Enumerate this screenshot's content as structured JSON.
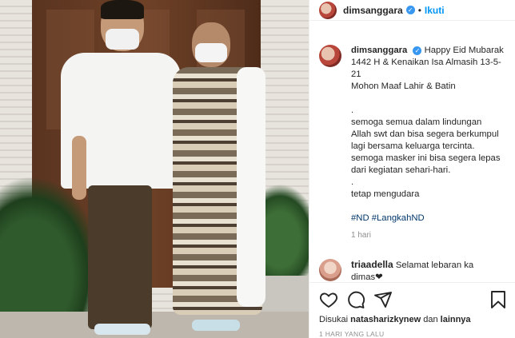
{
  "header": {
    "username": "dimsanggara",
    "separator": "•",
    "follow_label": "Ikuti"
  },
  "caption": {
    "username": "dimsanggara",
    "line1": "Happy Eid Mubarak",
    "line2": "1442 H & Kenaikan Isa Almasih 13-5-",
    "line3": "21",
    "line4": "Mohon Maaf Lahir & Batin",
    "dot1": ".",
    "line5": "semoga semua dalam lindungan",
    "line6": "Allah swt dan bisa segera berkumpul",
    "line7": "lagi bersama keluarga tercinta.",
    "line8": "semoga masker ini bisa segera lepas",
    "line9": "dari kegiatan sehari-hari.",
    "dot2": ".",
    "line10": "tetap mengudara",
    "hashtags": "#ND #LangkahND",
    "time": "1 hari"
  },
  "comment": {
    "username": "triaadella",
    "text": "Selamat lebaran ka",
    "text2": "dimas❤"
  },
  "actions": {
    "icons": [
      "heart-icon",
      "comment-icon",
      "share-icon",
      "bookmark-icon"
    ]
  },
  "likes": {
    "prefix": "Disukai ",
    "user": "natasharizkynew",
    "middle": " dan ",
    "others": "lainnya"
  },
  "date": "1 HARI YANG LALU",
  "colors": {
    "link_blue": "#0095f6",
    "verified_blue": "#3897f0",
    "hashtag": "#00376b",
    "muted": "#8e8e8e"
  }
}
